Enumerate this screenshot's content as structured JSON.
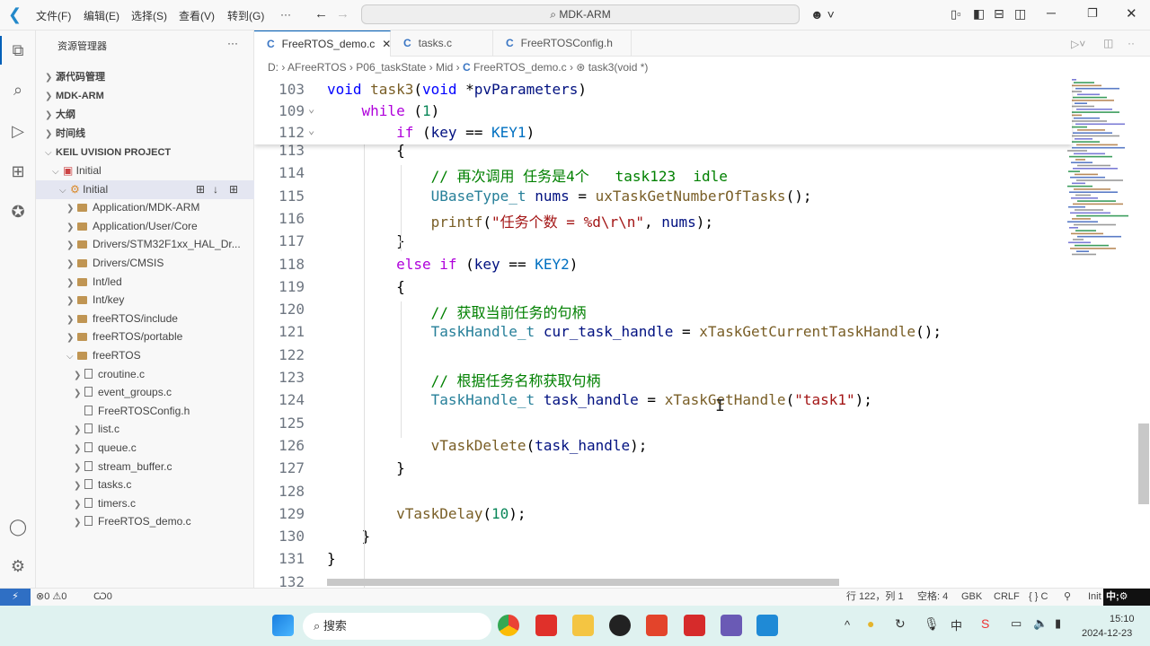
{
  "titlebar": {
    "menus": [
      "文件(F)",
      "编辑(E)",
      "选择(S)",
      "查看(V)",
      "转到(G)",
      "···"
    ],
    "search": "MDK-ARM"
  },
  "sidebar": {
    "title": "资源管理器",
    "more": "···",
    "sections": [
      "源代码管理",
      "MDK-ARM",
      "大纲",
      "时间线"
    ],
    "project_header": "KEIL UVISION PROJECT",
    "project": "Initial",
    "target": "Initial",
    "folders": [
      "Application/MDK-ARM",
      "Application/User/Core",
      "Drivers/STM32F1xx_HAL_Dr...",
      "Drivers/CMSIS",
      "Int/led",
      "Int/key",
      "freeRTOS/include",
      "freeRTOS/portable",
      "freeRTOS"
    ],
    "files": [
      "croutine.c",
      "event_groups.c",
      "FreeRTOSConfig.h",
      "list.c",
      "queue.c",
      "stream_buffer.c",
      "tasks.c",
      "timers.c",
      "FreeRTOS_demo.c"
    ]
  },
  "tabs": [
    {
      "label": "FreeRTOS_demo.c",
      "active": true
    },
    {
      "label": "tasks.c"
    },
    {
      "label": "FreeRTOSConfig.h"
    }
  ],
  "breadcrumb": [
    "D:",
    "AFreeRTOS",
    "P06_taskState",
    "Mid",
    "FreeRTOS_demo.c",
    "task3(void *)"
  ],
  "sticky": [
    {
      "n": "103",
      "t": [
        [
          "void",
          "ty"
        ],
        " ",
        [
          "task3",
          "fn"
        ],
        "(",
        [
          "void",
          "ty"
        ],
        " *",
        [
          "pvParameters",
          "va"
        ],
        ")"
      ]
    },
    {
      "n": "109",
      "t": [
        "    ",
        [
          "while",
          "kw"
        ],
        " (",
        [
          "1",
          "nu"
        ],
        ")"
      ]
    },
    {
      "n": "112",
      "t": [
        "        ",
        [
          "if",
          "kw"
        ],
        " (",
        [
          "key",
          "va"
        ],
        " == ",
        [
          "KEY1",
          "mc"
        ],
        ")"
      ]
    }
  ],
  "code": [
    {
      "n": "113",
      "t": [
        "        {"
      ]
    },
    {
      "n": "114",
      "t": [
        "            ",
        [
          "// 再次调用 任务是4个   task123  idle",
          "cm"
        ]
      ]
    },
    {
      "n": "115",
      "t": [
        "            ",
        [
          "UBaseType_t",
          "tp"
        ],
        " ",
        [
          "nums",
          "va"
        ],
        " = ",
        [
          "uxTaskGetNumberOfTasks",
          "fn"
        ],
        "();"
      ]
    },
    {
      "n": "116",
      "t": [
        "            ",
        [
          "printf",
          "fn"
        ],
        "(",
        [
          "\"任务个数 = %d\\r\\n\"",
          "st"
        ],
        ", ",
        [
          "nums",
          "va"
        ],
        ");"
      ]
    },
    {
      "n": "117",
      "t": [
        "        }"
      ]
    },
    {
      "n": "118",
      "t": [
        "        ",
        [
          "else",
          "kw"
        ],
        " ",
        [
          "if",
          "kw"
        ],
        " (",
        [
          "key",
          "va"
        ],
        " == ",
        [
          "KEY2",
          "mc"
        ],
        ")"
      ]
    },
    {
      "n": "119",
      "t": [
        "        {"
      ]
    },
    {
      "n": "120",
      "t": [
        "            ",
        [
          "// 获取当前任务的句柄",
          "cm"
        ]
      ]
    },
    {
      "n": "121",
      "t": [
        "            ",
        [
          "TaskHandle_t",
          "tp"
        ],
        " ",
        [
          "cur_task_handle",
          "va"
        ],
        " = ",
        [
          "xTaskGetCurrentTaskHandle",
          "fn"
        ],
        "();"
      ]
    },
    {
      "n": "122",
      "t": [
        ""
      ]
    },
    {
      "n": "123",
      "t": [
        "            ",
        [
          "// 根据任务名称获取句柄",
          "cm"
        ]
      ]
    },
    {
      "n": "124",
      "t": [
        "            ",
        [
          "TaskHandle_t",
          "tp"
        ],
        " ",
        [
          "task_handle",
          "va"
        ],
        " = ",
        [
          "xTaskGetHandle",
          "fn"
        ],
        "(",
        [
          "\"task1\"",
          "st"
        ],
        ");"
      ]
    },
    {
      "n": "125",
      "t": [
        ""
      ]
    },
    {
      "n": "126",
      "t": [
        "            ",
        [
          "vTaskDelete",
          "fn"
        ],
        "(",
        [
          "task_handle",
          "va"
        ],
        ");"
      ]
    },
    {
      "n": "127",
      "t": [
        "        }"
      ]
    },
    {
      "n": "128",
      "t": [
        ""
      ]
    },
    {
      "n": "129",
      "t": [
        "        ",
        [
          "vTaskDelay",
          "fn"
        ],
        "(",
        [
          "10",
          "nu"
        ],
        ");"
      ]
    },
    {
      "n": "130",
      "t": [
        "    }"
      ]
    },
    {
      "n": "131",
      "t": [
        "}"
      ]
    },
    {
      "n": "132",
      "t": [
        ""
      ]
    }
  ],
  "status": {
    "errors": "0",
    "warnings": "0",
    "ports": "0",
    "position": "行 122，列 1",
    "indent": "空格: 4",
    "encoding": "GBK",
    "eol": "CRLF",
    "language": "{ } C",
    "extra": "Init"
  },
  "taskbar": {
    "search": "搜索",
    "time": "15:10",
    "date": "2024-12-23",
    "ime": "中"
  },
  "colors": {
    "accent": "#005fb8",
    "remote": "#2f6fc4"
  }
}
